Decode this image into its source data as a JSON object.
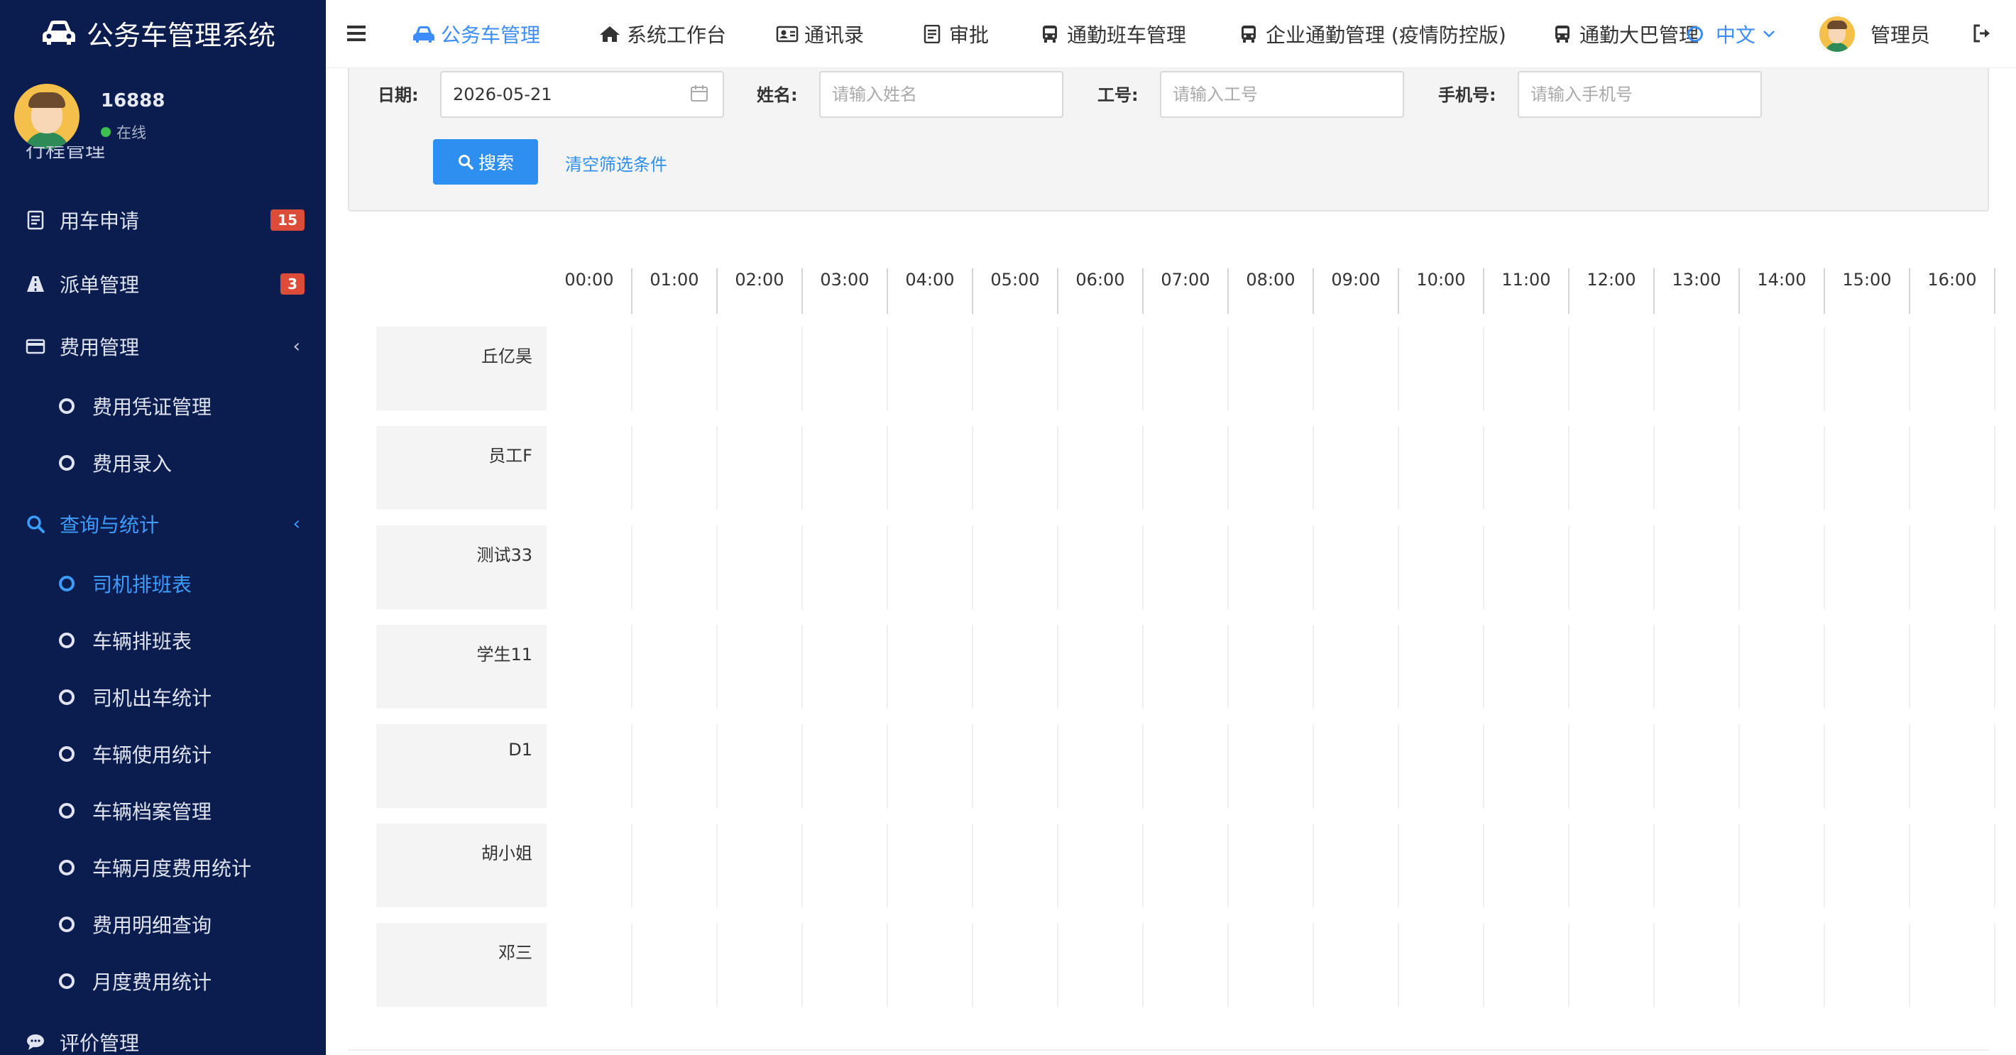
{
  "app": {
    "title": "公务车管理系统",
    "user": {
      "name": "16888",
      "status": "在线"
    }
  },
  "sidebar": {
    "cut_item": "行程管理",
    "items": [
      {
        "label": "用车申请",
        "badge": "15"
      },
      {
        "label": "派单管理",
        "badge": "3"
      },
      {
        "label": "费用管理"
      },
      {
        "label": "查询与统计"
      },
      {
        "label": "评价管理"
      }
    ],
    "fee_sub": [
      "费用凭证管理",
      "费用录入"
    ],
    "stats_sub": [
      "司机排班表",
      "车辆排班表",
      "司机出车统计",
      "车辆使用统计",
      "车辆档案管理",
      "车辆月度费用统计",
      "费用明细查询",
      "月度费用统计"
    ]
  },
  "topnav": {
    "items": [
      "公务车管理",
      "系统工作台",
      "通讯录",
      "审批",
      "通勤班车管理",
      "企业通勤管理 (疫情防控版)",
      "通勤大巴管理"
    ],
    "language": "中文",
    "admin": "管理员"
  },
  "filters": {
    "date_label": "日期:",
    "date_value": "2026-05-21",
    "name_label": "姓名:",
    "name_placeholder": "请输入姓名",
    "empno_label": "工号:",
    "empno_placeholder": "请输入工号",
    "phone_label": "手机号:",
    "phone_placeholder": "请输入手机号",
    "search_button": "搜索",
    "clear_link": "清空筛选条件"
  },
  "schedule": {
    "hours": [
      "00:00",
      "01:00",
      "02:00",
      "03:00",
      "04:00",
      "05:00",
      "06:00",
      "07:00",
      "08:00",
      "09:00",
      "10:00",
      "11:00",
      "12:00",
      "13:00",
      "14:00",
      "15:00",
      "16:00"
    ],
    "drivers": [
      "丘亿昊",
      "员工F",
      "测试33",
      "学生11",
      "D1",
      "胡小姐",
      "邓三"
    ]
  }
}
